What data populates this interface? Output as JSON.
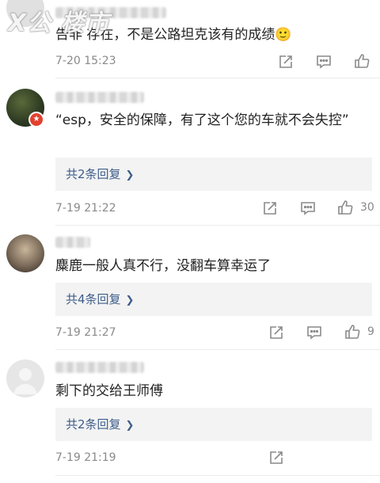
{
  "watermark": "X公 楼市",
  "comments": [
    {
      "text": "告非 存在，不是公路坦克该有的成绩🙂",
      "time": "7-20 15:23",
      "likes": ""
    },
    {
      "text": "“esp，安全的保障，有了这个您的车就不会失控”",
      "reply_label": "共2条回复",
      "time": "7-19 21:22",
      "likes": "30"
    },
    {
      "text": "麋鹿一般人真不行，没翻车算幸运了",
      "reply_label": "共4条回复",
      "time": "7-19 21:27",
      "likes": "9"
    },
    {
      "text": "剩下的交给王师傅",
      "reply_label": "共2条回复",
      "time": "7-19 21:19",
      "likes": ""
    }
  ],
  "icons": {
    "share": "share-icon",
    "comment": "comment-icon",
    "like": "like-icon",
    "chevron": "chevron-right-icon"
  },
  "colors": {
    "link": "#3d5d8a",
    "meta": "#8a8a8a",
    "badge": "#e2412e"
  }
}
